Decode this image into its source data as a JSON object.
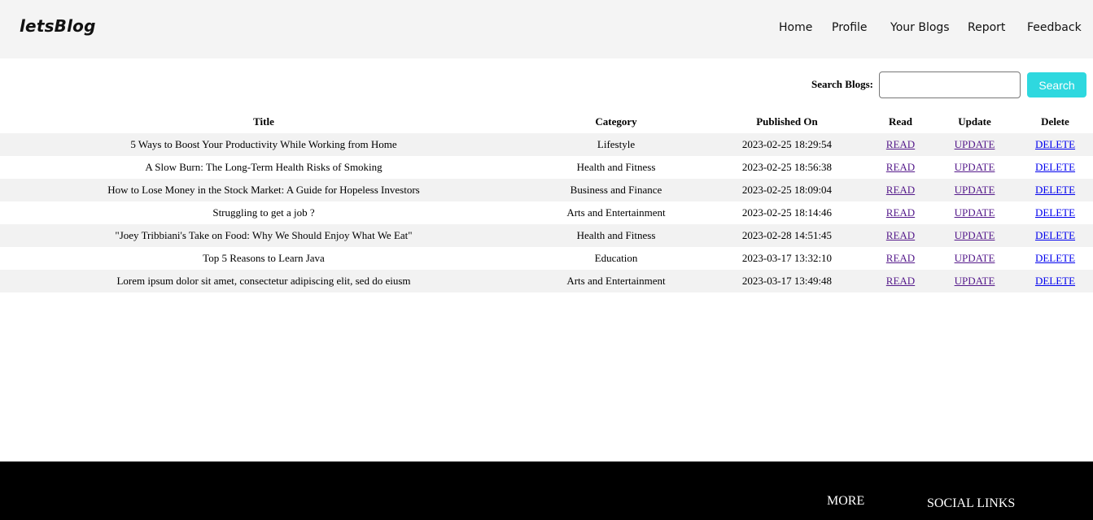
{
  "header": {
    "brand": "letsBlog",
    "nav": [
      "Home",
      "Profile",
      "Your Blogs",
      "Report",
      "Feedback"
    ]
  },
  "search": {
    "label": "Search Blogs:",
    "value": "",
    "button": "Search"
  },
  "table": {
    "headers": [
      "Title",
      "Category",
      "Published On",
      "Read",
      "Update",
      "Delete"
    ],
    "rows": [
      {
        "title": "5 Ways to Boost Your Productivity While Working from Home",
        "category": "Lifestyle",
        "published": "2023-02-25 18:29:54",
        "read": "READ",
        "update": "UPDATE",
        "delete": "DELETE"
      },
      {
        "title": "A Slow Burn: The Long-Term Health Risks of Smoking",
        "category": "Health and Fitness",
        "published": "2023-02-25 18:56:38",
        "read": "READ",
        "update": "UPDATE",
        "delete": "DELETE"
      },
      {
        "title": "How to Lose Money in the Stock Market: A Guide for Hopeless Investors",
        "category": "Business and Finance",
        "published": "2023-02-25 18:09:04",
        "read": "READ",
        "update": "UPDATE",
        "delete": "DELETE"
      },
      {
        "title": "Struggling to get a job ?",
        "category": "Arts and Entertainment",
        "published": "2023-02-25 18:14:46",
        "read": "READ",
        "update": "UPDATE",
        "delete": "DELETE"
      },
      {
        "title": "\"Joey Tribbiani's Take on Food: Why We Should Enjoy What We Eat\"",
        "category": "Health and Fitness",
        "published": "2023-02-28 14:51:45",
        "read": "READ",
        "update": "UPDATE",
        "delete": "DELETE"
      },
      {
        "title": "Top 5 Reasons to Learn Java",
        "category": "Education",
        "published": "2023-03-17 13:32:10",
        "read": "READ",
        "update": "UPDATE",
        "delete": "DELETE"
      },
      {
        "title": "Lorem ipsum dolor sit amet, consectetur adipiscing elit, sed do eiusm",
        "category": "Arts and Entertainment",
        "published": "2023-03-17 13:49:48",
        "read": "READ",
        "update": "UPDATE",
        "delete": "DELETE"
      }
    ]
  },
  "footer": {
    "more": "MORE",
    "social": "SOCIAL LINKS"
  },
  "colors": {
    "navbar_bg": "#f4f4f4",
    "search_button": "#2ed8df",
    "row_stripe": "#f2f2f2",
    "visited_link": "#551a8b",
    "link": "#0000ee",
    "footer_bg": "#000000"
  }
}
